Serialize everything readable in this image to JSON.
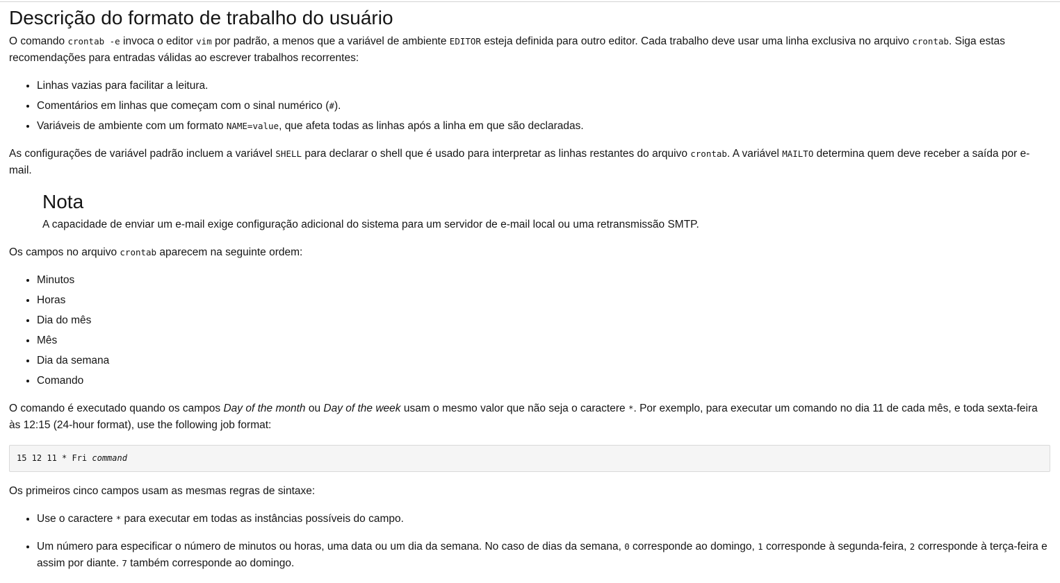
{
  "heading": "Descrição do formato de trabalho do usuário",
  "intro": {
    "t1": "O comando ",
    "c1": "crontab -e",
    "t2": " invoca o editor ",
    "c2": "vim",
    "t3": " por padrão, a menos que a variável de ambiente ",
    "c3": "EDITOR",
    "t4": " esteja definida para outro editor. Cada trabalho deve usar uma linha exclusiva no arquivo ",
    "c4": "crontab",
    "t5": ". Siga estas recomendações para entradas válidas ao escrever trabalhos recorrentes:"
  },
  "recommendations": {
    "item1": "Linhas vazias para facilitar a leitura.",
    "item2_a": "Comentários em linhas que começam com o sinal numérico (",
    "item2_code": "#",
    "item2_b": ").",
    "item3_a": "Variáveis de ambiente com um formato ",
    "item3_code": "NAME=value",
    "item3_b": ", que afeta todas as linhas após a linha em que são declaradas."
  },
  "defaults": {
    "t1": "As configurações de variável padrão incluem a variável ",
    "c1": "SHELL",
    "t2": " para declarar o shell que é usado para interpretar as linhas restantes do arquivo ",
    "c2": "crontab",
    "t3": ". A variável ",
    "c3": "MAILTO",
    "t4": " determina quem deve receber a saída por e-mail."
  },
  "note": {
    "title": "Nota",
    "text": "A capacidade de enviar um e-mail exige configuração adicional do sistema para um servidor de e-mail local ou uma retransmissão SMTP."
  },
  "fields_intro": {
    "t1": "Os campos no arquivo ",
    "c1": "crontab",
    "t2": " aparecem na seguinte ordem:"
  },
  "fields": [
    "Minutos",
    "Horas",
    "Dia do mês",
    "Mês",
    "Dia da semana",
    "Comando"
  ],
  "execution": {
    "t1": "O comando é executado quando os campos ",
    "em1": "Day of the month",
    "t2": " ou ",
    "em2": "Day of the week",
    "t3": " usam o mesmo valor que não seja o caractere ",
    "c1": "*",
    "t4": ". Por exemplo, para executar um comando no dia 11 de cada mês, e toda sexta-feira às 12:15 (24-hour format), use the following job format:"
  },
  "code_block": {
    "plain": "15 12 11 * Fri ",
    "emph": "command"
  },
  "syntax_intro": "Os primeiros cinco campos usam as mesmas regras de sintaxe:",
  "syntax_rules": {
    "r1_a": "Use o caractere ",
    "r1_code": "*",
    "r1_b": " para executar em todas as instâncias possíveis do campo.",
    "r2_a": "Um número para especificar o número de minutos ou horas, uma data ou um dia da semana. No caso de dias da semana, ",
    "r2_c0": "0",
    "r2_b": " corresponde ao domingo, ",
    "r2_c1": "1",
    "r2_c": " corresponde à segunda-feira, ",
    "r2_c2": "2",
    "r2_d": " corresponde à terça-feira e assim por diante. ",
    "r2_c7": "7",
    "r2_e": " também corresponde ao domingo."
  }
}
